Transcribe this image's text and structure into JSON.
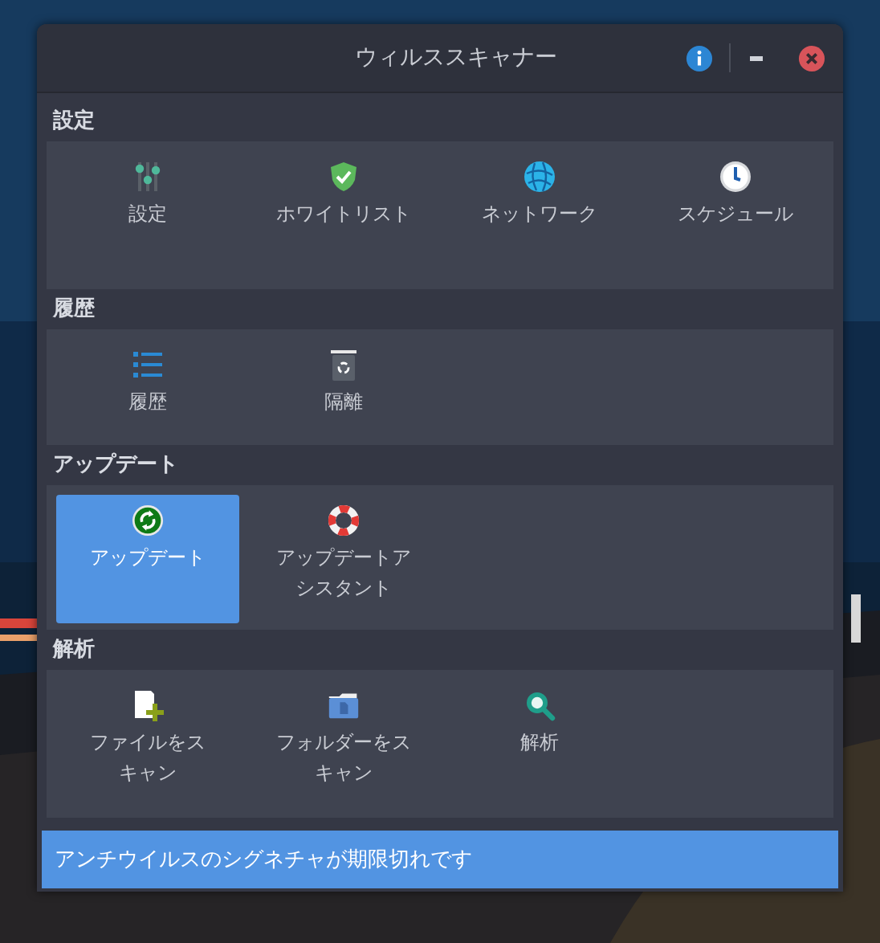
{
  "window": {
    "title": "ウィルススキャナー"
  },
  "sections": [
    {
      "title": "設定",
      "items": [
        {
          "label": "設定",
          "selected": false
        },
        {
          "label": "ホワイトリスト",
          "selected": false
        },
        {
          "label": "ネットワーク",
          "selected": false
        },
        {
          "label": "スケジュール",
          "selected": false
        }
      ]
    },
    {
      "title": "履歴",
      "items": [
        {
          "label": "履歴",
          "selected": false
        },
        {
          "label": "隔離",
          "selected": false
        }
      ]
    },
    {
      "title": "アップデート",
      "items": [
        {
          "label": "アップデート",
          "selected": true
        },
        {
          "label": "アップデートアシスタント",
          "selected": false
        }
      ]
    },
    {
      "title": "解析",
      "items": [
        {
          "label": "ファイルをスキャン",
          "selected": false
        },
        {
          "label": "フォルダーをスキャン",
          "selected": false
        },
        {
          "label": "解析",
          "selected": false
        }
      ]
    }
  ],
  "status_bar": {
    "message": "アンチウイルスのシグネチャが期限切れです"
  }
}
